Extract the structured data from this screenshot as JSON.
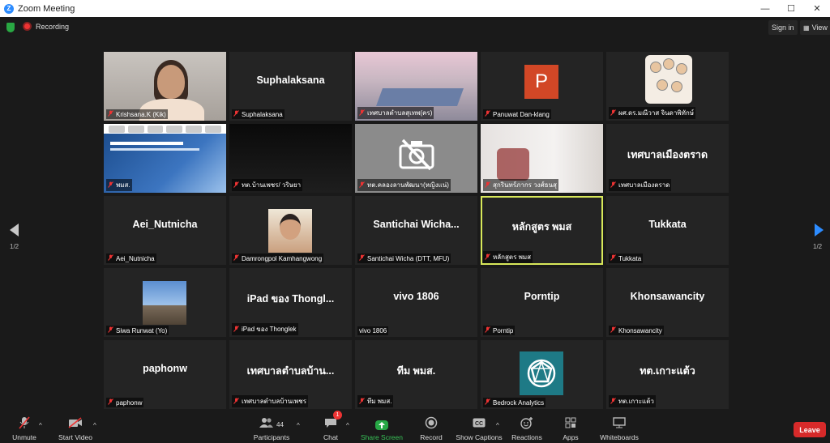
{
  "window": {
    "title": "Zoom Meeting",
    "minimize": "—",
    "maximize": "☐",
    "close": "✕",
    "logo_letter": "Z"
  },
  "top": {
    "recording": "Recording",
    "sign_in": "Sign in",
    "view": "View"
  },
  "pagination": {
    "left": "1/2",
    "right": "1/2"
  },
  "tiles": [
    {
      "type": "person",
      "big": "",
      "name": "Krishsana.K (Kik)"
    },
    {
      "type": "text",
      "big": "Suphalaksana",
      "name": "Suphalaksana"
    },
    {
      "type": "room",
      "big": "",
      "name": "เทศบาลตำบลสุเทพ(คร)"
    },
    {
      "type": "avatar-p",
      "big": "",
      "name": "Panuwat Dan-klang",
      "avatar_letter": "P"
    },
    {
      "type": "cartoon",
      "big": "",
      "name": "ผศ.ดร.มณีวาส จินดาพิทักษ์"
    },
    {
      "type": "slide",
      "big": "",
      "name": "พมส."
    },
    {
      "type": "dark",
      "big": "",
      "name": "ทต.บ้านเพชร/ วริษยา"
    },
    {
      "type": "gray",
      "big": "",
      "name": "ทต.คลองลานพัฒนา(หญิงแน่)"
    },
    {
      "type": "white",
      "big": "",
      "name": "สุกรินทร์ภากร วงศ์ธนสุ"
    },
    {
      "type": "text",
      "big": "เทศบาลเมืองตราด",
      "name": "เทศบาลเมืองตราด"
    },
    {
      "type": "text",
      "big": "Aei_Nutnicha",
      "name": "Aei_Nutnicha"
    },
    {
      "type": "portrait",
      "big": "",
      "name": "Damrongpol Kamhangwong"
    },
    {
      "type": "text",
      "big": "Santichai  Wicha...",
      "name": "Santichai Wicha (DTT, MFU)"
    },
    {
      "type": "text-active",
      "big": "หลักสูตร พมส",
      "name": "หลักสูตร พมส"
    },
    {
      "type": "text",
      "big": "Tukkata",
      "name": "Tukkata"
    },
    {
      "type": "landscape",
      "big": "",
      "name": "Siwa Runwat (Yo)"
    },
    {
      "type": "text",
      "big": "iPad ของ Thongl...",
      "name": "iPad ของ Thonglek"
    },
    {
      "type": "text-nomute",
      "big": "vivo 1806",
      "name": "vivo 1806"
    },
    {
      "type": "text",
      "big": "Porntip",
      "name": "Porntip"
    },
    {
      "type": "text",
      "big": "Khonsawancity",
      "name": "Khonsawancity"
    },
    {
      "type": "text",
      "big": "paphonw",
      "name": "paphonw"
    },
    {
      "type": "text",
      "big": "เทศบาลตำบลบ้าน...",
      "name": "เทศบาลตำบลบ้านเพชร"
    },
    {
      "type": "text",
      "big": "ทีม พมส.",
      "name": "ทีม พมส."
    },
    {
      "type": "logo",
      "big": "",
      "name": "Bedrock Analytics"
    },
    {
      "type": "text",
      "big": "ทต.เกาะแต้ว",
      "name": "ทต.เกาะแต้ว"
    }
  ],
  "toolbar": {
    "unmute": "Unmute",
    "start_video": "Start Video",
    "participants": "Participants",
    "participants_count": "44",
    "chat": "Chat",
    "chat_badge": "1",
    "share_screen": "Share Screen",
    "record": "Record",
    "show_captions": "Show Captions",
    "reactions": "Reactions",
    "apps": "Apps",
    "whiteboards": "Whiteboards",
    "leave": "Leave"
  },
  "colors": {
    "accent": "#2d8cff",
    "share": "#27a845",
    "leave": "#d72a2a",
    "active_speaker": "#d8e85a"
  }
}
